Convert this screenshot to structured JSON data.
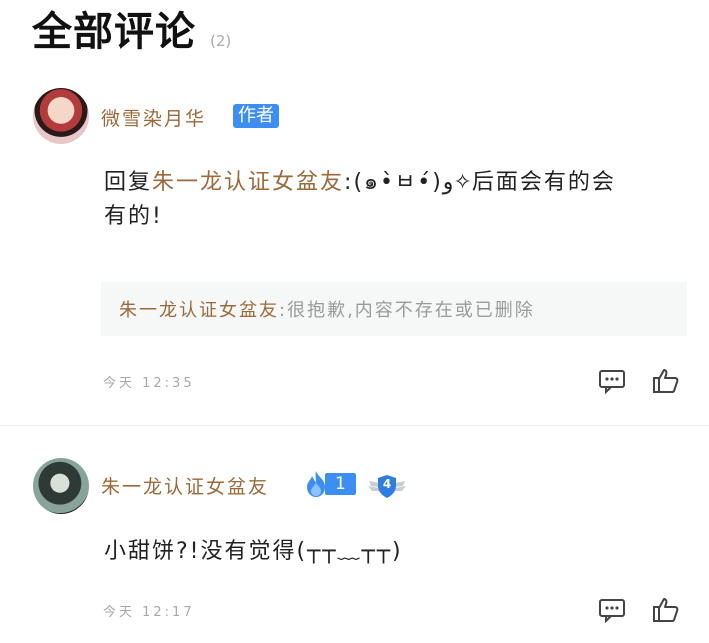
{
  "header": {
    "title": "全部评论",
    "count": "(2)"
  },
  "comments": [
    {
      "author": "微雪染月华",
      "author_badge": "作者",
      "reply_prefix": "回复",
      "reply_to": "朱一龙认证女盆友",
      "reply_colon": ":",
      "text_line1": "(๑•̀ㅂ•́)و✧后面会有的会",
      "text_line2": "有的!",
      "quote": {
        "name": "朱一龙认证女盆友",
        "text": ":很抱歉,内容不存在或已删除"
      },
      "time": "今天 12:35",
      "icons": {
        "comment": "comment-icon",
        "like": "thumbs-up-icon"
      }
    },
    {
      "author": "朱一龙认证女盆友",
      "fan_level": "1",
      "vip_level": "4",
      "text": "小甜饼?!没有觉得(┬┬﹏┬┬)",
      "time": "今天 12:17",
      "icons": {
        "comment": "comment-icon",
        "like": "thumbs-up-icon"
      }
    }
  ]
}
